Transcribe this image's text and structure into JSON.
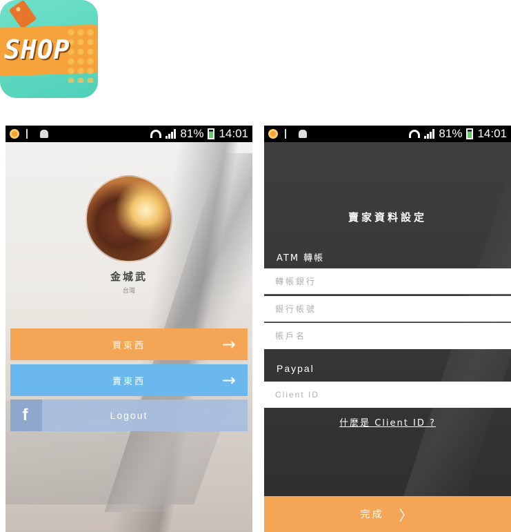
{
  "app_icon": {
    "label": "SHOP"
  },
  "status_bar": {
    "battery": "81%",
    "time": "14:01"
  },
  "left_screen": {
    "user_name": "金城武",
    "user_location": "台灣",
    "buy_button": "買東西",
    "sell_button": "賣東西",
    "facebook_glyph": "f",
    "logout_button": "Logout",
    "arrow_glyph": "→"
  },
  "right_screen": {
    "title": "賣家資料設定",
    "atm_section": "ATM 轉帳",
    "bank_placeholder": "轉帳銀行",
    "account_placeholder": "銀行帳號",
    "holder_placeholder": "帳戶名",
    "paypal_section": "Paypal",
    "client_id_placeholder": "Client ID",
    "help_link": "什麼是 Client ID ?",
    "done_button": "完成",
    "chevron_glyph": "〉"
  },
  "colors": {
    "orange_accent": "#f4a555",
    "blue_accent": "#6ab8ee",
    "facebook_tint": "#a6bede",
    "dark_bg": "#3a3a3a"
  }
}
